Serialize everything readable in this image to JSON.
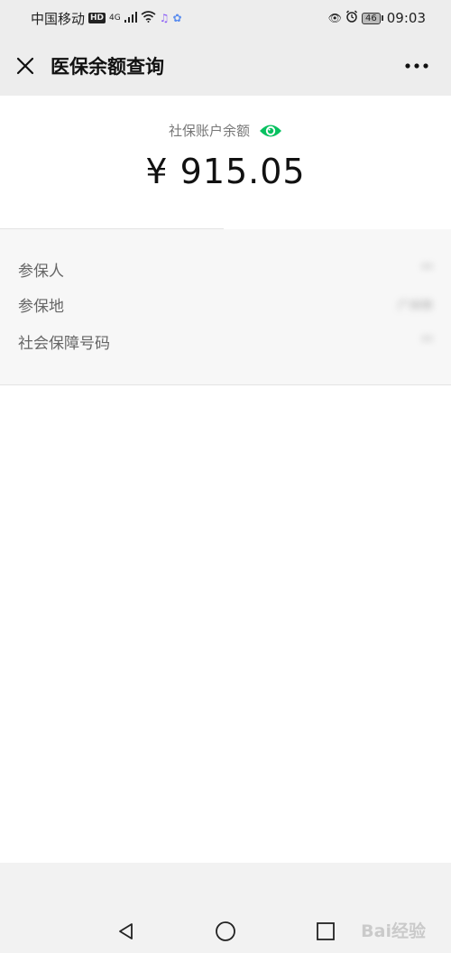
{
  "status_bar": {
    "carrier": "中国移动",
    "hd_badge": "HD",
    "signal_label": "4G",
    "battery_level": "46",
    "time": "09:03"
  },
  "nav": {
    "title": "医保余额查询"
  },
  "balance": {
    "label": "社保账户余额",
    "amount": "¥ 915.05"
  },
  "info": {
    "rows": [
      {
        "label": "参保人",
        "value": "**"
      },
      {
        "label": "参保地",
        "value": "广州市"
      },
      {
        "label": "社会保障号码",
        "value": "**"
      }
    ]
  },
  "watermark": {
    "text": "Bai经验"
  },
  "colors": {
    "accent": "#07c160",
    "nav_bg": "#ededed",
    "info_bg": "#f7f7f7"
  }
}
